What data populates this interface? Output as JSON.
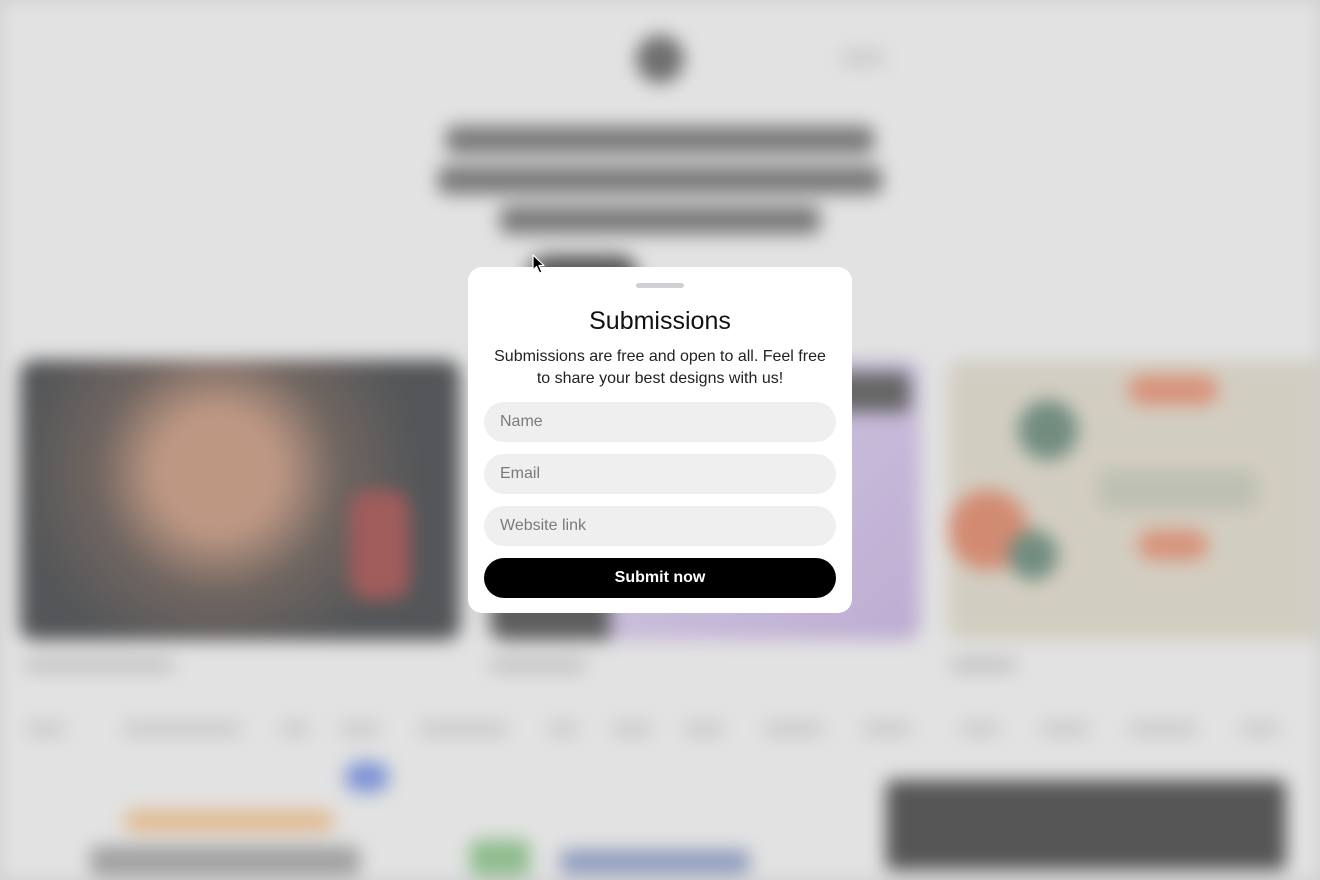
{
  "modal": {
    "title": "Submissions",
    "description": "Submissions are free and open to all. Feel free to share your best designs with us!",
    "fields": {
      "name_placeholder": "Name",
      "email_placeholder": "Email",
      "website_placeholder": "Website link"
    },
    "submit_label": "Submit now"
  },
  "colors": {
    "submit_background": "#000000",
    "field_background": "#efefef",
    "modal_background": "#ffffff"
  },
  "icons": {
    "pointer": "cursor-arrow-icon"
  }
}
